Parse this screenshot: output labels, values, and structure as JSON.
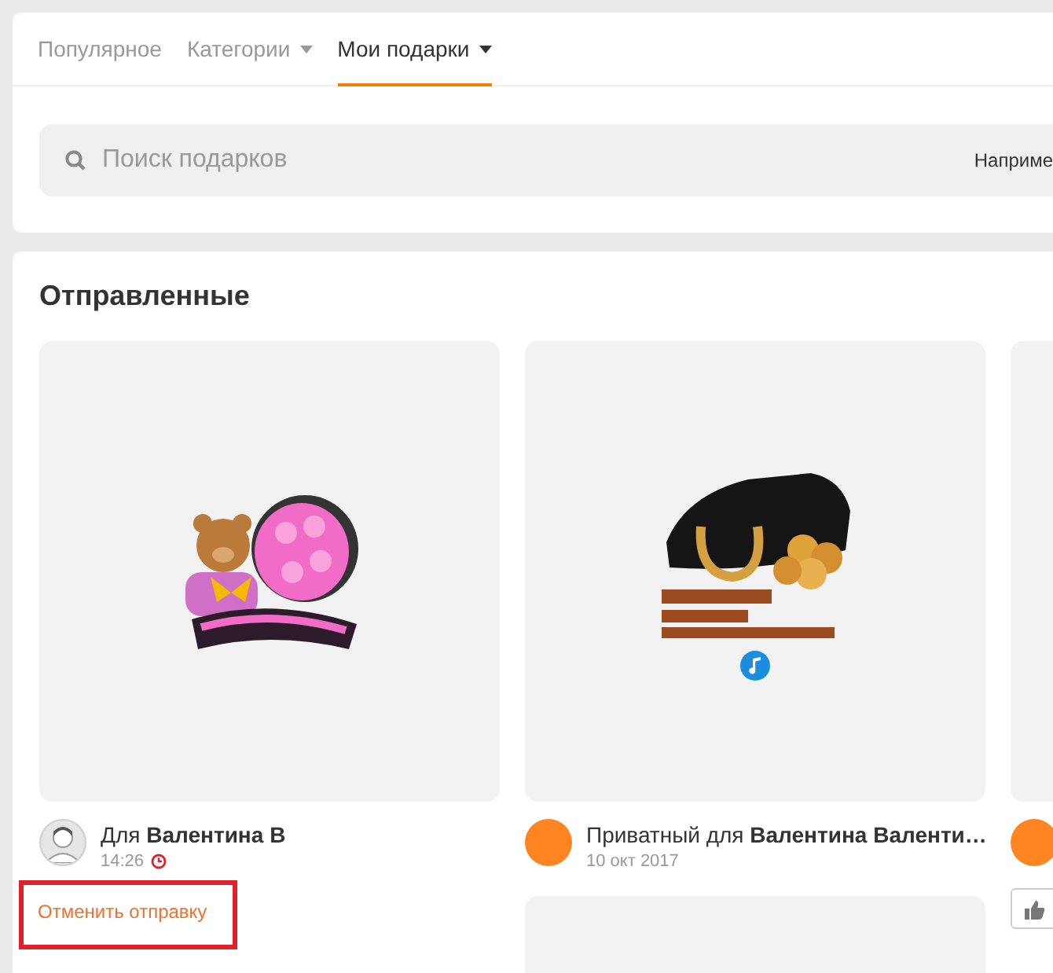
{
  "tabs": [
    {
      "label": "Популярное",
      "selected": false,
      "dropdown": false
    },
    {
      "label": "Категории",
      "selected": false,
      "dropdown": true
    },
    {
      "label": "Мои подарки",
      "selected": true,
      "dropdown": true
    }
  ],
  "search": {
    "placeholder": "Поиск подарков",
    "hint": "Наприме"
  },
  "section_title": "Отправленные",
  "gifts": [
    {
      "kind": "bear",
      "music": false,
      "default_avatar": true,
      "recipient": "Для **Валентина В**",
      "time": "14:26",
      "pending": true,
      "action": "Отменить отправку",
      "highlighted": true,
      "next_gift": false
    },
    {
      "kind": "car",
      "music": true,
      "default_avatar": false,
      "recipient": "Приватный для **Валентина Валенти…**",
      "time": "10 окт 2017",
      "pending": false,
      "next_gift": true
    },
    {
      "kind": "blank",
      "music": false,
      "default_avatar": false,
      "like_button": true
    }
  ]
}
